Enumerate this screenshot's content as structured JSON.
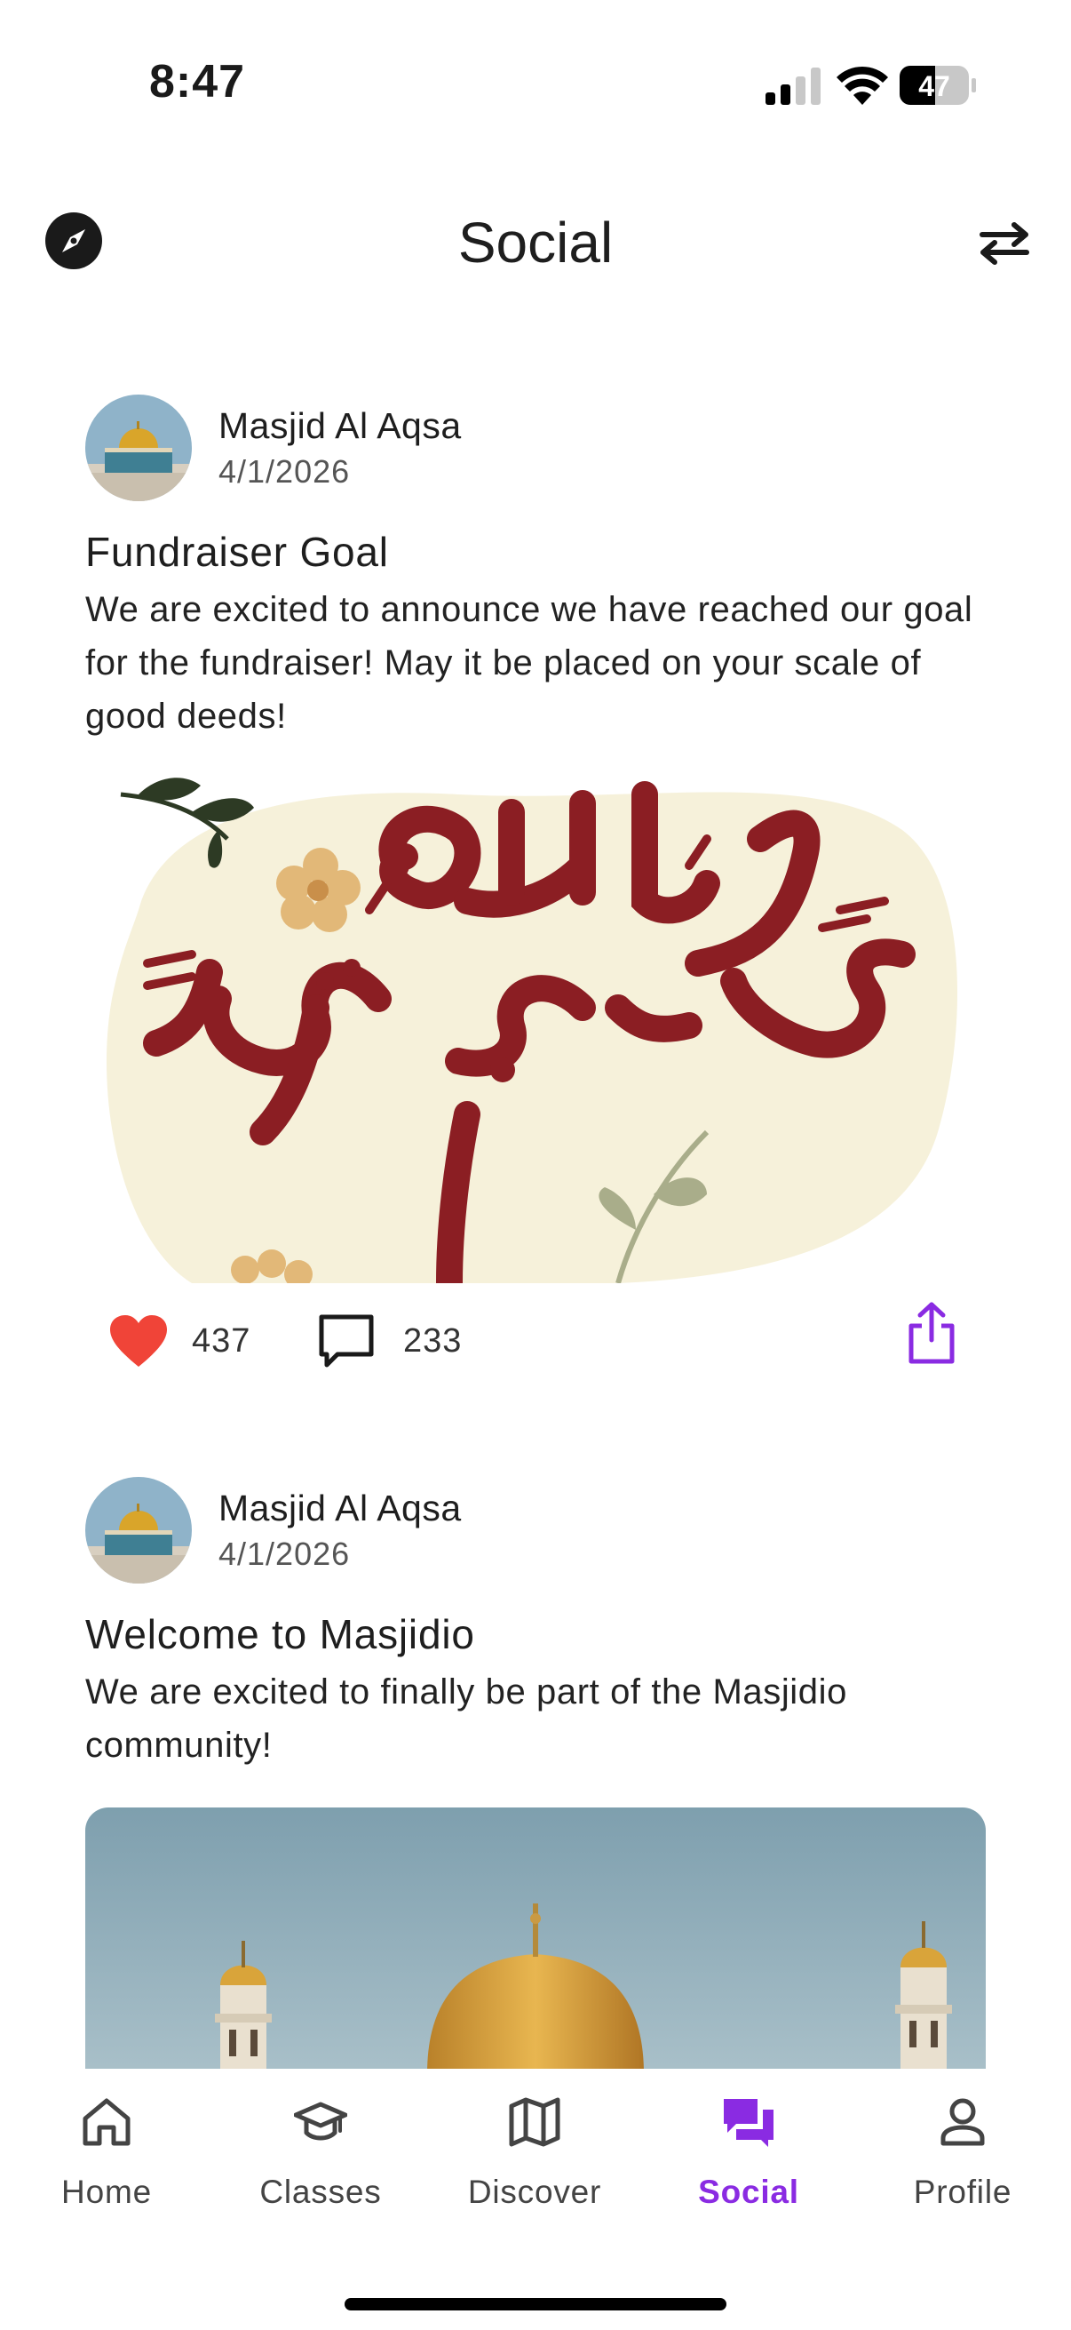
{
  "status_bar": {
    "time": "8:47",
    "battery": "47"
  },
  "header": {
    "title": "Social",
    "left_icon": "compass-icon",
    "right_icon": "swap-arrows-icon"
  },
  "posts": [
    {
      "author": "Masjid Al Aqsa",
      "date": "4/1/2026",
      "title": "Fundraiser Goal",
      "body": "We are excited to announce we have reached our goal for the fundraiser! May it be placed on your scale of good deeds!",
      "likes": "437",
      "comments": "233"
    },
    {
      "author": "Masjid Al Aqsa",
      "date": "4/1/2026",
      "title": "Welcome to Masjidio",
      "body": "We are excited to finally be part of the Masjidio community!"
    }
  ],
  "tabs": [
    {
      "label": "Home",
      "icon": "home-icon"
    },
    {
      "label": "Classes",
      "icon": "graduation-cap-icon"
    },
    {
      "label": "Discover",
      "icon": "map-icon"
    },
    {
      "label": "Social",
      "icon": "chat-bubbles-icon",
      "active": true
    },
    {
      "label": "Profile",
      "icon": "person-icon"
    }
  ],
  "colors": {
    "accent": "#8a2be2",
    "like": "#f04438",
    "calligraphy": "#8b1e23"
  }
}
